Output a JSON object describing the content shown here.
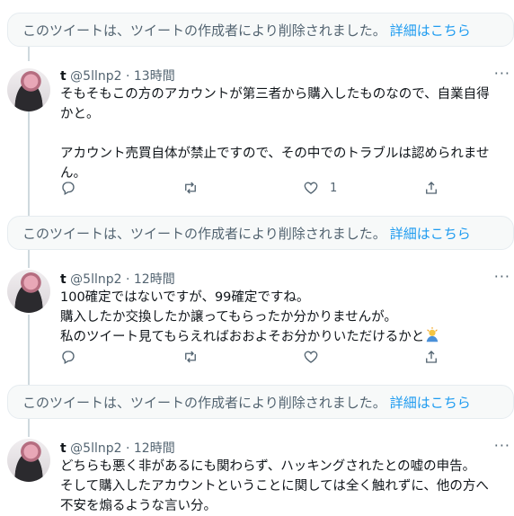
{
  "deleted_notice": {
    "text": "このツイートは、ツイートの作成者により削除されました。",
    "link": "詳細はこちら"
  },
  "tweets": [
    {
      "name": "t",
      "handle": "@5llnp2",
      "separator": "·",
      "time": "13時間",
      "lines": [
        "そもそもこの方のアカウントが第三者から購入したものなので、自業自得",
        "かと。",
        "",
        "アカウント売買自体が禁止ですので、その中でのトラブルは認められませ",
        "ん。"
      ],
      "like_count": "1"
    },
    {
      "name": "t",
      "handle": "@5llnp2",
      "separator": "·",
      "time": "12時間",
      "lines": [
        "100確定ではないですが、99確定ですね。",
        "購入したか交換したか譲ってもらったか分かりませんが。",
        "私のツイート見てもらえればおおよそお分かりいただけるかと"
      ],
      "emoji": "person-bowing-emoji",
      "like_count": ""
    },
    {
      "name": "t",
      "handle": "@5llnp2",
      "separator": "·",
      "time": "12時間",
      "lines": [
        "どちらも悪く非があるにも関わらず、ハッキングされたとの嘘の申告。",
        "そして購入したアカウントということに関しては全く触れずに、他の方へ",
        "不安を煽るような言い分。"
      ],
      "like_count": ""
    }
  ],
  "colors": {
    "accent": "#1d9bf0",
    "muted": "#536471",
    "notice_bg": "#f7f9f9",
    "thread_line": "#cfd9de"
  },
  "icons": [
    "reply-icon",
    "retweet-icon",
    "like-icon",
    "share-icon",
    "more-icon"
  ]
}
